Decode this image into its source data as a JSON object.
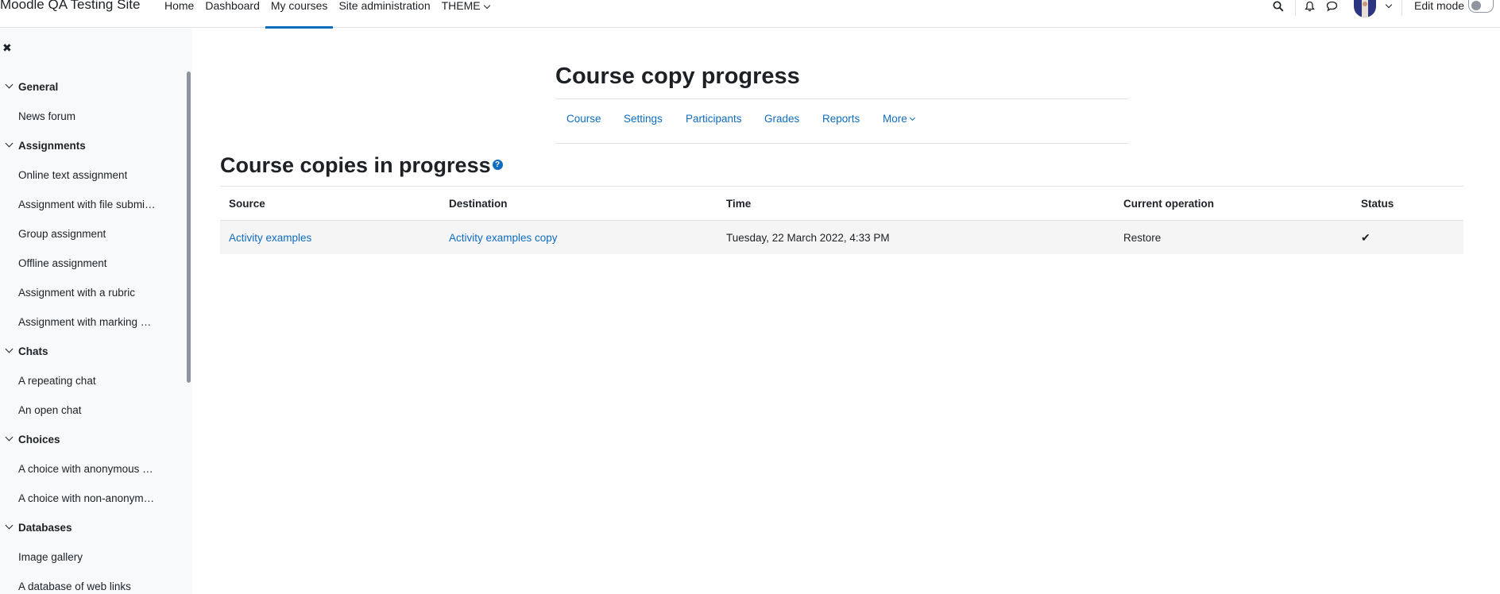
{
  "site": {
    "name": "Moodle QA Testing Site"
  },
  "primary_nav": [
    {
      "label": "Home",
      "active": false
    },
    {
      "label": "Dashboard",
      "active": false
    },
    {
      "label": "My courses",
      "active": true
    },
    {
      "label": "Site administration",
      "active": false
    },
    {
      "label": "THEME",
      "active": false,
      "has_dropdown": true
    }
  ],
  "user_menu": {
    "edit_mode_label": "Edit mode",
    "edit_mode_on": false
  },
  "icons": {
    "search": "search-icon",
    "notifications": "bell-icon",
    "messages": "chat-bubble-icon",
    "close_drawer": "close-icon",
    "help": "question-circle-icon",
    "status_done": "check-icon"
  },
  "colors": {
    "link": "#0f6cbf",
    "text": "#1d2125",
    "drawer_bg": "#f8f9fa",
    "row_bg": "#f5f5f5"
  },
  "course_index": [
    {
      "section": "General",
      "items": [
        "News forum"
      ]
    },
    {
      "section": "Assignments",
      "items": [
        "Online text assignment",
        "Assignment with file submi…",
        "Group assignment",
        "Offline assignment",
        "Assignment with a rubric",
        "Assignment with marking …"
      ]
    },
    {
      "section": "Chats",
      "items": [
        "A repeating chat",
        "An open chat"
      ]
    },
    {
      "section": "Choices",
      "items": [
        "A choice with anonymous …",
        "A choice with non-anonym…"
      ]
    },
    {
      "section": "Databases",
      "items": [
        "Image gallery",
        "A database of web links"
      ]
    }
  ],
  "page": {
    "title": "Course copy progress",
    "secondary_nav": [
      "Course",
      "Settings",
      "Participants",
      "Grades",
      "Reports",
      "More"
    ],
    "section_title": "Course copies in progress",
    "help_glyph": "?"
  },
  "table": {
    "headers": [
      "Source",
      "Destination",
      "Time",
      "Current operation",
      "Status"
    ],
    "rows": [
      {
        "source": "Activity examples",
        "destination": "Activity examples copy",
        "time": "Tuesday, 22 March 2022, 4:33 PM",
        "operation": "Restore",
        "status": "complete"
      }
    ]
  }
}
